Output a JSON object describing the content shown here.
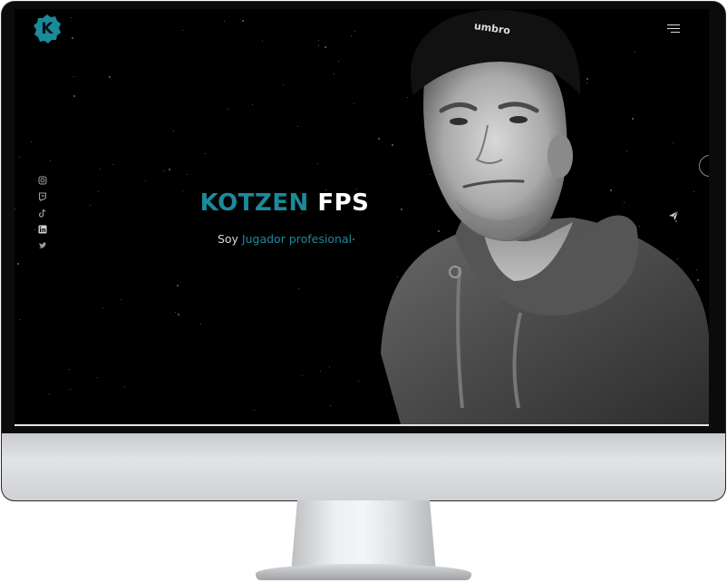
{
  "brand": {
    "logo_letter": "K",
    "accent_color": "#1b8a9a",
    "logo_icon": "k-badge-icon"
  },
  "header": {
    "menu_icon": "hamburger-menu-icon"
  },
  "social": {
    "items": [
      {
        "name": "instagram-icon"
      },
      {
        "name": "twitch-icon"
      },
      {
        "name": "tiktok-icon"
      },
      {
        "name": "linkedin-icon"
      },
      {
        "name": "twitter-icon"
      }
    ]
  },
  "hero": {
    "title_part1": "KOTZEN",
    "title_part2": "FPS",
    "subtitle_prefix": "Soy",
    "subtitle_role": "Jugador profesional"
  },
  "controls": {
    "side_button_icon": "circle-button",
    "contact_icon": "send-paper-plane-icon"
  }
}
